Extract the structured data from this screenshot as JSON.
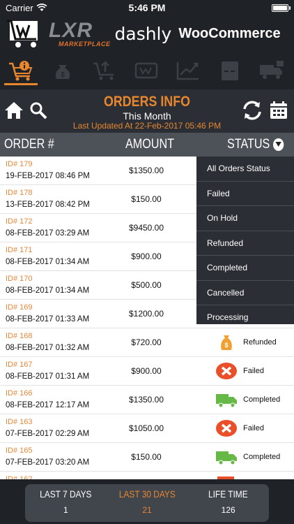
{
  "status_bar": {
    "carrier": "Carrier",
    "time": "5:46 PM"
  },
  "brand": {
    "lxr": "LXR",
    "marketplace": "MARKETPLACE",
    "dashly": "dashly",
    "woocommerce": "WooCommerce"
  },
  "tabs": [
    {
      "icon": "orders-info-icon",
      "active": true
    },
    {
      "icon": "revenue-icon",
      "active": false
    },
    {
      "icon": "product-upload-icon",
      "active": false
    },
    {
      "icon": "cart-transfer-icon",
      "active": false
    },
    {
      "icon": "sales-growth-icon",
      "active": false
    },
    {
      "icon": "report-icon",
      "active": false
    },
    {
      "icon": "shipping-truck-icon",
      "active": false
    }
  ],
  "header": {
    "title": "ORDERS INFO",
    "period": "This Month",
    "updated": "Last Updated At 22-Feb-2017 05:46 PM"
  },
  "table": {
    "col_order": "ORDER #",
    "col_amount": "AMOUNT",
    "col_status": "STATUS"
  },
  "orders": [
    {
      "id": "ID# 179",
      "date": "19-FEB-2017 08:46 PM",
      "amount": "$1350.00",
      "status": ""
    },
    {
      "id": "ID# 178",
      "date": "13-FEB-2017 08:42 PM",
      "amount": "$150.00",
      "status": ""
    },
    {
      "id": "ID# 172",
      "date": "08-FEB-2017 03:29 AM",
      "amount": "$9450.00",
      "status": ""
    },
    {
      "id": "ID# 171",
      "date": "08-FEB-2017 01:34 AM",
      "amount": "$900.00",
      "status": ""
    },
    {
      "id": "ID# 170",
      "date": "08-FEB-2017 01:34 AM",
      "amount": "$500.00",
      "status": ""
    },
    {
      "id": "ID# 169",
      "date": "08-FEB-2017 01:33 AM",
      "amount": "$1200.00",
      "status": ""
    },
    {
      "id": "ID# 168",
      "date": "08-FEB-2017 01:32 AM",
      "amount": "$720.00",
      "status": "Refunded",
      "icon": "refund-money-bag-icon"
    },
    {
      "id": "ID# 167",
      "date": "08-FEB-2017 01:31 AM",
      "amount": "$900.00",
      "status": "Failed",
      "icon": "failed-x-icon"
    },
    {
      "id": "ID# 166",
      "date": "08-FEB-2017 12:17 AM",
      "amount": "$1350.00",
      "status": "Completed",
      "icon": "delivery-truck-icon"
    },
    {
      "id": "ID# 163",
      "date": "07-FEB-2017 02:29 AM",
      "amount": "$1050.00",
      "status": "Failed",
      "icon": "failed-x-icon"
    },
    {
      "id": "ID# 165",
      "date": "07-FEB-2017 03:20 AM",
      "amount": "$150.00",
      "status": "Completed",
      "icon": "delivery-truck-icon"
    },
    {
      "id": "ID# 162",
      "date": "",
      "amount": "",
      "status": "",
      "icon": "status-icon-partial"
    }
  ],
  "status_filter": [
    "All Orders Status",
    "Failed",
    "On Hold",
    "Refunded",
    "Completed",
    "Cancelled",
    "Processing"
  ],
  "summary": [
    {
      "label": "LAST 7 DAYS",
      "value": "1",
      "active": false
    },
    {
      "label": "LAST 30 DAYS",
      "value": "21",
      "active": true
    },
    {
      "label": "LIFE TIME",
      "value": "126",
      "active": false
    }
  ],
  "colors": {
    "accent": "#e8862e",
    "background": "#1f2226",
    "panel": "#2b2f35",
    "failed": "#e9502a",
    "completed": "#66b847",
    "refunded": "#f0a030"
  }
}
